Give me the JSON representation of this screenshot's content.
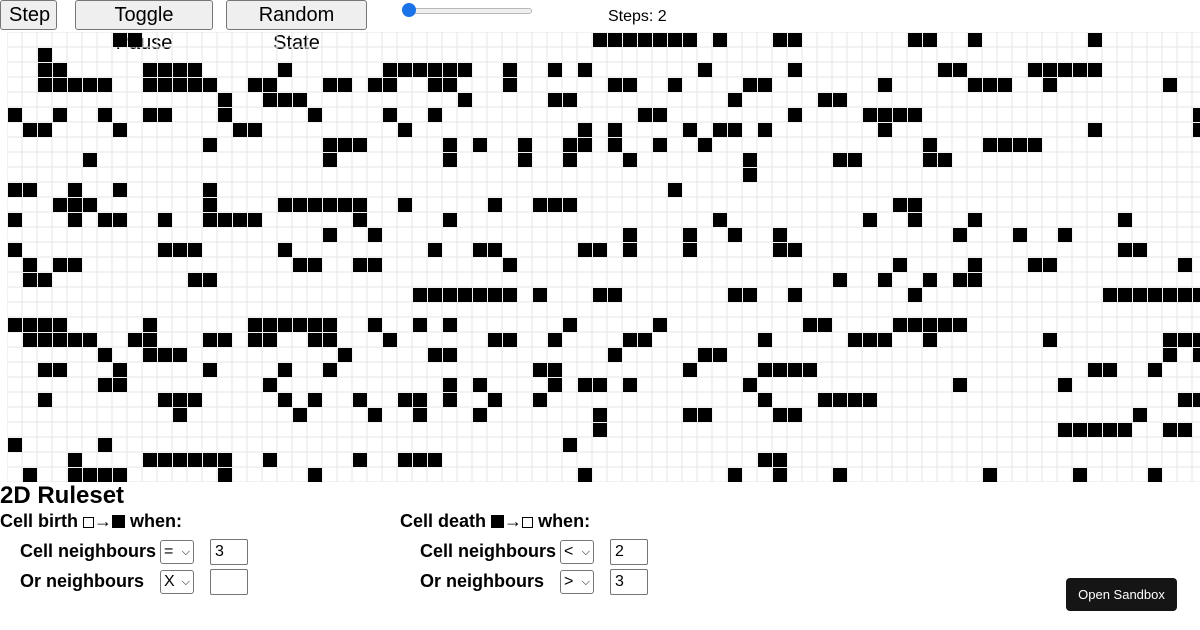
{
  "toolbar": {
    "step_label": "Step",
    "pause_label": "Toggle Pause",
    "random_label": "Random State",
    "speed_fraction": 0.0,
    "steps_text": "Steps: 2"
  },
  "ruleset": {
    "title": "2D Ruleset",
    "birth": {
      "title_pre": "Cell birth",
      "title_post": "when:",
      "row1": {
        "label": "Cell neighbours",
        "op": "=",
        "value": "3"
      },
      "row2": {
        "label": "Or neighbours",
        "op": "X",
        "value": ""
      }
    },
    "death": {
      "title_pre": "Cell death",
      "title_post": "when:",
      "row1": {
        "label": "Cell neighbours",
        "op": "<",
        "value": "2"
      },
      "row2": {
        "label": "Or neighbours",
        "op": ">",
        "value": "3"
      }
    },
    "arrow": "→"
  },
  "sandbox_label": "Open Sandbox",
  "colors": {
    "alive": "#000000",
    "dead": "#ffffff",
    "gridline": "#e6e6e6"
  },
  "grid": {
    "rows": [
      ".......##..............................#######.#...##.......##..#.......#............#######...............",
      "......#..#..........................................................................................................",
      "..##.#..........##.....####.....#......######..#..#.#.......#.....#.........##....#####.......................",
      ".#####.##.......###....#####..#####..##...##.##..##...#......##..#....##.......#.....###..#.......#.......#####",
      "..#.#..##.......###.......................#..###..........#.....##..........#.....##...........................",
      "..##..#......................#.....#..#..#..##...#.....#....#..#.............##........#....####................",
      "....#......#....................#..........##....#.......##.........#...........#.#....#.##.#.......#.........",
      "..#...####....................##..#...........................#.......###.....#.#..#..##.#..#..#............",
      "..##....##......................#.........#.......#..........#...............#.......#....#..#...#.......#...",
      "...#..............................#####..##....###..#...#....................................................",
      "..#...........................................#.#...#.............#...##..#..#.....#............................",
      "..###.....................##.......................................###..........###.......#....######..#.....#",
      "...#.................#.........#..#...#.........#.....#....#.......##....#..........#...#.##..#..####......#..",
      "...#..#................#...#..#..#...........#...#..#........................................................",
      "#.....#.........#..##.....##.#...#.....##.....................##..........######..........##......#.........##",
      "..............##..##........#.........................#....#...##........#.#....##.................#....#.#.##",
      "....##.........##.........................................#..#..#.##........................................."
    ]
  }
}
